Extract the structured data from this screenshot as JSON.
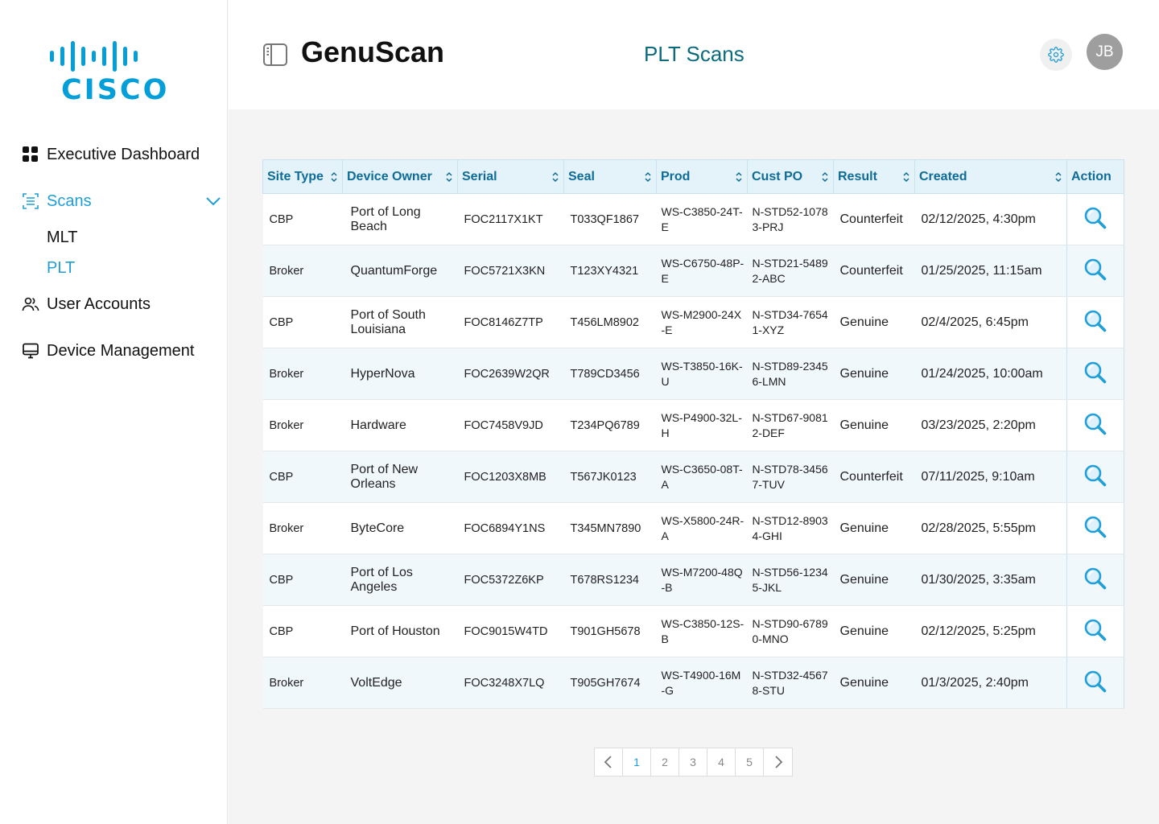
{
  "brand": {
    "logo_text": "CISCO"
  },
  "sidebar": {
    "items": [
      {
        "label": "Executive Dashboard",
        "icon": "grid-icon"
      },
      {
        "label": "Scans",
        "icon": "scan-icon",
        "active": true,
        "children": [
          {
            "label": "MLT"
          },
          {
            "label": "PLT",
            "active": true
          }
        ]
      },
      {
        "label": "User Accounts",
        "icon": "users-icon"
      },
      {
        "label": "Device Management",
        "icon": "monitor-icon"
      }
    ]
  },
  "header": {
    "app_title": "GenuScan",
    "page_title": "PLT Scans",
    "avatar_initials": "JB"
  },
  "table": {
    "columns": [
      "Site Type",
      "Device Owner",
      "Serial",
      "Seal",
      "Prod",
      "Cust PO",
      "Result",
      "Created",
      "Action"
    ],
    "rows": [
      {
        "site": "CBP",
        "owner": "Port of Long Beach",
        "serial": "FOC2117X1KT",
        "seal": "T033QF1867",
        "prod": "WS-C3850-24T-E",
        "cust": "N-STD52-10783-PRJ",
        "result": "Counterfeit",
        "created": "02/12/2025, 4:30pm"
      },
      {
        "site": "Broker",
        "owner": "QuantumForge",
        "serial": "FOC5721X3KN",
        "seal": "T123XY4321",
        "prod": "WS-C6750-48P-E",
        "cust": "N-STD21-54892-ABC",
        "result": "Counterfeit",
        "created": "01/25/2025, 11:15am"
      },
      {
        "site": "CBP",
        "owner": "Port of South Louisiana",
        "serial": "FOC8146Z7TP",
        "seal": "T456LM8902",
        "prod": "WS-M2900-24X-E",
        "cust": "N-STD34-76541-XYZ",
        "result": "Genuine",
        "created": "02/4/2025, 6:45pm"
      },
      {
        "site": "Broker",
        "owner": "HyperNova",
        "serial": "FOC2639W2QR",
        "seal": "T789CD3456",
        "prod": "WS-T3850-16K-U",
        "cust": "N-STD89-23456-LMN",
        "result": "Genuine",
        "created": "01/24/2025, 10:00am"
      },
      {
        "site": "Broker",
        "owner": "Hardware",
        "serial": "FOC7458V9JD",
        "seal": "T234PQ6789",
        "prod": "WS-P4900-32L-H",
        "cust": "N-STD67-90812-DEF",
        "result": "Genuine",
        "created": "03/23/2025, 2:20pm"
      },
      {
        "site": "CBP",
        "owner": "Port of New Orleans",
        "serial": "FOC1203X8MB",
        "seal": "T567JK0123",
        "prod": "WS-C3650-08T-A",
        "cust": "N-STD78-34567-TUV",
        "result": "Counterfeit",
        "created": "07/11/2025, 9:10am"
      },
      {
        "site": "Broker",
        "owner": "ByteCore",
        "serial": "FOC6894Y1NS",
        "seal": "T345MN7890",
        "prod": "WS-X5800-24R-A",
        "cust": "N-STD12-89034-GHI",
        "result": "Genuine",
        "created": "02/28/2025, 5:55pm"
      },
      {
        "site": "CBP",
        "owner": "Port of Los Angeles",
        "serial": "FOC5372Z6KP",
        "seal": "T678RS1234",
        "prod": "WS-M7200-48Q-B",
        "cust": "N-STD56-12345-JKL",
        "result": "Genuine",
        "created": "01/30/2025, 3:35am"
      },
      {
        "site": "CBP",
        "owner": "Port of Houston",
        "serial": "FOC9015W4TD",
        "seal": "T901GH5678",
        "prod": "WS-C3850-12S-B",
        "cust": "N-STD90-67890-MNO",
        "result": "Genuine",
        "created": "02/12/2025, 5:25pm"
      },
      {
        "site": "Broker",
        "owner": "VoltEdge",
        "serial": "FOC3248X7LQ",
        "seal": "T905GH7674",
        "prod": "WS-T4900-16M-G",
        "cust": "N-STD32-45678-STU",
        "result": "Genuine",
        "created": "01/3/2025, 2:40pm"
      }
    ]
  },
  "pagination": {
    "pages": [
      "1",
      "2",
      "3",
      "4",
      "5"
    ],
    "current": "1"
  },
  "colors": {
    "accent": "#1f9ed8",
    "header_bg": "#e4f2fa",
    "header_text": "#0e6c96",
    "page_title": "#0c6b7d",
    "cisco_blue": "#049fd9"
  }
}
